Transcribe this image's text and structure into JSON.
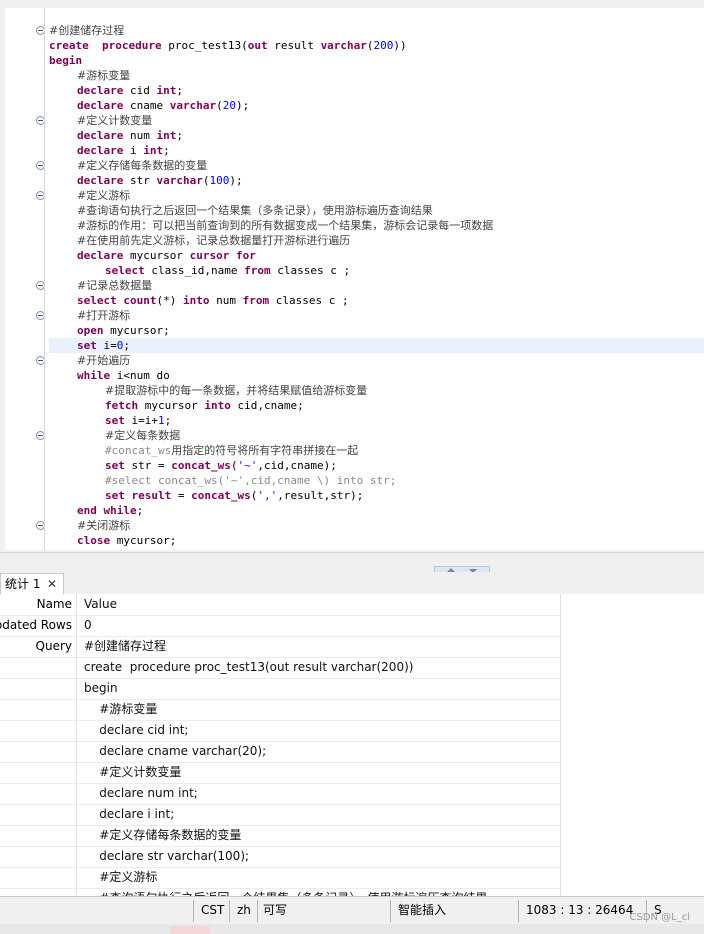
{
  "editor": {
    "lines": [
      {
        "fold": true,
        "indent": 0,
        "tokens": [
          {
            "t": "#创建储存过程",
            "c": "cmt-cn"
          }
        ]
      },
      {
        "fold": false,
        "indent": 0,
        "tokens": [
          {
            "t": "create",
            "c": "kw"
          },
          {
            "t": "  ",
            "c": ""
          },
          {
            "t": "procedure",
            "c": "kw"
          },
          {
            "t": " proc_test13(",
            "c": ""
          },
          {
            "t": "out",
            "c": "kw"
          },
          {
            "t": " result ",
            "c": ""
          },
          {
            "t": "varchar",
            "c": "kw"
          },
          {
            "t": "(",
            "c": ""
          },
          {
            "t": "200",
            "c": "num"
          },
          {
            "t": "))",
            "c": ""
          }
        ]
      },
      {
        "fold": false,
        "indent": 0,
        "tokens": [
          {
            "t": "begin",
            "c": "kw"
          }
        ]
      },
      {
        "fold": false,
        "indent": 1,
        "tokens": [
          {
            "t": "#游标变量",
            "c": "cmt-cn"
          }
        ]
      },
      {
        "fold": false,
        "indent": 1,
        "tokens": [
          {
            "t": "declare",
            "c": "kw"
          },
          {
            "t": " cid ",
            "c": ""
          },
          {
            "t": "int",
            "c": "kw"
          },
          {
            "t": ";",
            "c": ""
          }
        ]
      },
      {
        "fold": false,
        "indent": 1,
        "tokens": [
          {
            "t": "declare",
            "c": "kw"
          },
          {
            "t": " cname ",
            "c": ""
          },
          {
            "t": "varchar",
            "c": "kw"
          },
          {
            "t": "(",
            "c": ""
          },
          {
            "t": "20",
            "c": "num"
          },
          {
            "t": ");",
            "c": ""
          }
        ]
      },
      {
        "fold": true,
        "indent": 1,
        "tokens": [
          {
            "t": "#定义计数变量",
            "c": "cmt-cn"
          }
        ]
      },
      {
        "fold": false,
        "indent": 1,
        "tokens": [
          {
            "t": "declare",
            "c": "kw"
          },
          {
            "t": " num ",
            "c": ""
          },
          {
            "t": "int",
            "c": "kw"
          },
          {
            "t": ";",
            "c": ""
          }
        ]
      },
      {
        "fold": false,
        "indent": 1,
        "tokens": [
          {
            "t": "declare",
            "c": "kw"
          },
          {
            "t": " i ",
            "c": ""
          },
          {
            "t": "int",
            "c": "kw"
          },
          {
            "t": ";",
            "c": ""
          }
        ]
      },
      {
        "fold": true,
        "indent": 1,
        "tokens": [
          {
            "t": "#定义存储每条数据的变量",
            "c": "cmt-cn"
          }
        ]
      },
      {
        "fold": false,
        "indent": 1,
        "tokens": [
          {
            "t": "declare",
            "c": "kw"
          },
          {
            "t": " str ",
            "c": ""
          },
          {
            "t": "varchar",
            "c": "kw"
          },
          {
            "t": "(",
            "c": ""
          },
          {
            "t": "100",
            "c": "num"
          },
          {
            "t": ");",
            "c": ""
          }
        ]
      },
      {
        "fold": true,
        "indent": 1,
        "tokens": [
          {
            "t": "#定义游标",
            "c": "cmt-cn"
          }
        ]
      },
      {
        "fold": false,
        "indent": 1,
        "tokens": [
          {
            "t": "#查询语句执行之后返回一个结果集（多条记录），使用游标遍历查询结果",
            "c": "cmt-cn"
          }
        ]
      },
      {
        "fold": false,
        "indent": 1,
        "tokens": [
          {
            "t": "#游标的作用：可以把当前查询到的所有数据变成一个结果集，游标会记录每一项数据",
            "c": "cmt-cn"
          }
        ]
      },
      {
        "fold": false,
        "indent": 1,
        "tokens": [
          {
            "t": "#在使用前先定义游标，记录总数据量打开游标进行遍历",
            "c": "cmt-cn"
          }
        ]
      },
      {
        "fold": false,
        "indent": 1,
        "tokens": [
          {
            "t": "declare",
            "c": "kw"
          },
          {
            "t": " mycursor ",
            "c": ""
          },
          {
            "t": "cursor",
            "c": "kw"
          },
          {
            "t": " ",
            "c": ""
          },
          {
            "t": "for",
            "c": "kw"
          }
        ]
      },
      {
        "fold": false,
        "indent": 2,
        "tokens": [
          {
            "t": "select",
            "c": "kw"
          },
          {
            "t": " class_id,name ",
            "c": ""
          },
          {
            "t": "from",
            "c": "kw"
          },
          {
            "t": " classes c ;",
            "c": ""
          }
        ]
      },
      {
        "fold": true,
        "indent": 1,
        "tokens": [
          {
            "t": "#记录总数据量",
            "c": "cmt-cn"
          }
        ]
      },
      {
        "fold": false,
        "indent": 1,
        "tokens": [
          {
            "t": "select",
            "c": "kw"
          },
          {
            "t": " ",
            "c": ""
          },
          {
            "t": "count",
            "c": "kw"
          },
          {
            "t": "(*) ",
            "c": ""
          },
          {
            "t": "into",
            "c": "kw"
          },
          {
            "t": " num ",
            "c": ""
          },
          {
            "t": "from",
            "c": "kw"
          },
          {
            "t": " classes c ;",
            "c": ""
          }
        ]
      },
      {
        "fold": true,
        "indent": 1,
        "tokens": [
          {
            "t": "#打开游标",
            "c": "cmt-cn"
          }
        ]
      },
      {
        "fold": false,
        "indent": 1,
        "tokens": [
          {
            "t": "open",
            "c": "kw"
          },
          {
            "t": " mycursor;",
            "c": ""
          }
        ]
      },
      {
        "fold": false,
        "indent": 1,
        "current": true,
        "tokens": [
          {
            "t": "set",
            "c": "kw"
          },
          {
            "t": " i=",
            "c": ""
          },
          {
            "t": "0",
            "c": "num"
          },
          {
            "t": ";",
            "c": ""
          }
        ]
      },
      {
        "fold": true,
        "indent": 1,
        "tokens": [
          {
            "t": "#开始遍历",
            "c": "cmt-cn"
          }
        ]
      },
      {
        "fold": false,
        "indent": 1,
        "tokens": [
          {
            "t": "while",
            "c": "kw"
          },
          {
            "t": " i<num do",
            "c": ""
          }
        ]
      },
      {
        "fold": false,
        "indent": 2,
        "tokens": [
          {
            "t": "#提取游标中的每一条数据，并将结果赋值给游标变量",
            "c": "cmt-cn"
          }
        ]
      },
      {
        "fold": false,
        "indent": 2,
        "tokens": [
          {
            "t": "fetch",
            "c": "kw"
          },
          {
            "t": " mycursor ",
            "c": ""
          },
          {
            "t": "into",
            "c": "kw"
          },
          {
            "t": " cid,cname;",
            "c": ""
          }
        ]
      },
      {
        "fold": false,
        "indent": 2,
        "tokens": [
          {
            "t": "set",
            "c": "kw"
          },
          {
            "t": " i=i+",
            "c": ""
          },
          {
            "t": "1",
            "c": "num"
          },
          {
            "t": ";",
            "c": ""
          }
        ]
      },
      {
        "fold": true,
        "indent": 2,
        "tokens": [
          {
            "t": "#定义每条数据",
            "c": "cmt-cn"
          }
        ]
      },
      {
        "fold": false,
        "indent": 2,
        "tokens": [
          {
            "t": "#concat_ws",
            "c": "cmt-gray"
          },
          {
            "t": "用指定的符号将所有字符串拼接在一起",
            "c": "cmt-cn"
          }
        ]
      },
      {
        "fold": false,
        "indent": 2,
        "tokens": [
          {
            "t": "set",
            "c": "kw"
          },
          {
            "t": " str = ",
            "c": ""
          },
          {
            "t": "concat_ws",
            "c": "kw"
          },
          {
            "t": "(",
            "c": ""
          },
          {
            "t": "'~'",
            "c": "str"
          },
          {
            "t": ",cid,cname);",
            "c": ""
          }
        ]
      },
      {
        "fold": false,
        "indent": 2,
        "tokens": [
          {
            "t": "#select concat_ws('~',cid,cname \\) into str;",
            "c": "cmt-gray"
          }
        ]
      },
      {
        "fold": false,
        "indent": 2,
        "tokens": [
          {
            "t": "set",
            "c": "kw"
          },
          {
            "t": " ",
            "c": ""
          },
          {
            "t": "result",
            "c": "kw"
          },
          {
            "t": " = ",
            "c": ""
          },
          {
            "t": "concat_ws",
            "c": "kw"
          },
          {
            "t": "(",
            "c": ""
          },
          {
            "t": "','",
            "c": "str"
          },
          {
            "t": ",result,str);",
            "c": ""
          }
        ]
      },
      {
        "fold": false,
        "indent": 1,
        "tokens": [
          {
            "t": "end",
            "c": "kw"
          },
          {
            "t": " ",
            "c": ""
          },
          {
            "t": "while",
            "c": "kw"
          },
          {
            "t": ";",
            "c": ""
          }
        ]
      },
      {
        "fold": true,
        "indent": 1,
        "tokens": [
          {
            "t": "#关闭游标",
            "c": "cmt-cn"
          }
        ]
      },
      {
        "fold": false,
        "indent": 1,
        "tokens": [
          {
            "t": "close",
            "c": "kw"
          },
          {
            "t": " mycursor;",
            "c": ""
          }
        ]
      }
    ]
  },
  "tab": {
    "label": "统计 1",
    "close": "✕"
  },
  "grid": {
    "header": {
      "c1": "Name",
      "c2": "Value"
    },
    "rows": [
      {
        "c1": "Updated Rows",
        "c2": "0"
      },
      {
        "c1": "Query",
        "c2": "#创建储存过程"
      },
      {
        "c1": "",
        "c2": "create  procedure proc_test13(out result varchar(200))"
      },
      {
        "c1": "",
        "c2": "begin"
      },
      {
        "c1": "",
        "c2": "    #游标变量"
      },
      {
        "c1": "",
        "c2": "    declare cid int;"
      },
      {
        "c1": "",
        "c2": "    declare cname varchar(20);"
      },
      {
        "c1": "",
        "c2": "    #定义计数变量"
      },
      {
        "c1": "",
        "c2": "    declare num int;"
      },
      {
        "c1": "",
        "c2": "    declare i int;"
      },
      {
        "c1": "",
        "c2": "    #定义存储每条数据的变量"
      },
      {
        "c1": "",
        "c2": "    declare str varchar(100);"
      },
      {
        "c1": "",
        "c2": "    #定义游标"
      },
      {
        "c1": "",
        "c2": "    #查询语句执行之后返回一个结果集（多条记录），使用游标遍历查询结果"
      }
    ]
  },
  "status": {
    "timezone": "CST",
    "lang": "zh",
    "mode": "可写",
    "insert": "智能插入",
    "position": "1083 : 13 : 26464",
    "extra": "S"
  },
  "watermark": "CSDN @L_cl",
  "colors": {
    "keyword": "#7f0055",
    "number": "#0000ff",
    "current_line": "#e8f2fe"
  }
}
